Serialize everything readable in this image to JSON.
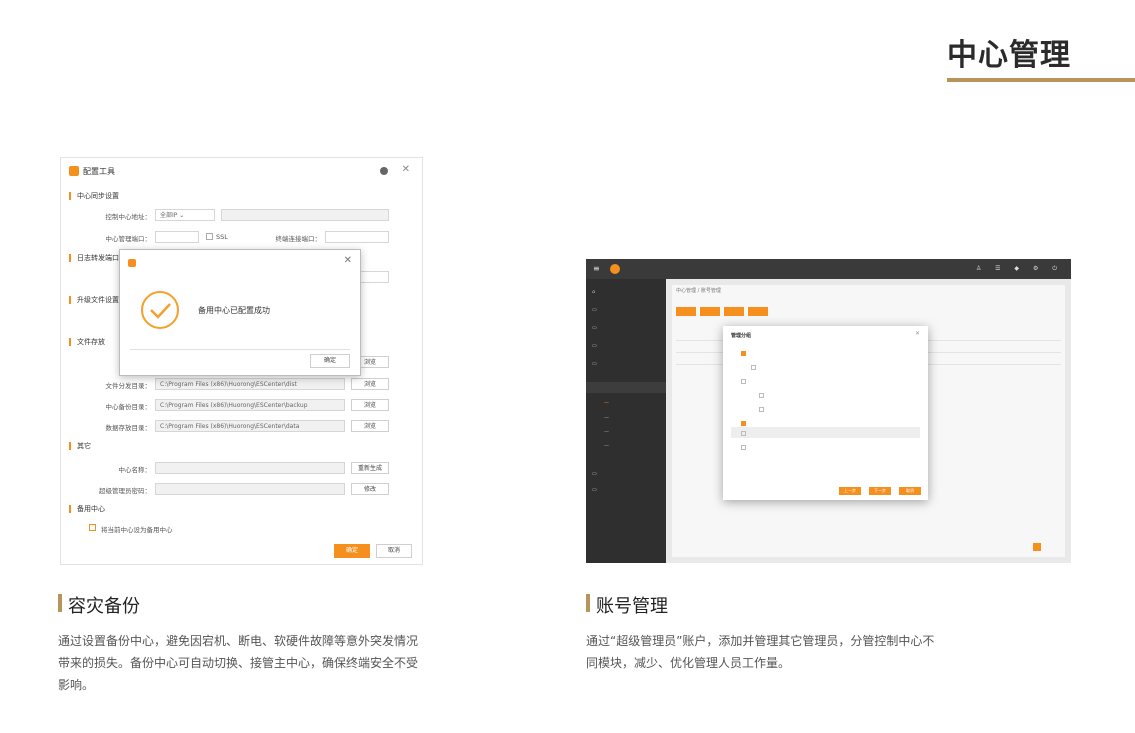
{
  "page": {
    "title": "中心管理",
    "accent": "#b8935a",
    "brand": "#f5901e"
  },
  "left_shot": {
    "title": "配置工具",
    "sections": {
      "sync": "中心同步设置",
      "forward": "日志转发端口",
      "upgrade": "升级文件设置",
      "storage": "文件存放",
      "other": "其它",
      "backup": "备用中心"
    },
    "fields": {
      "master_label": "控制中心地址：",
      "master_value": "全部IP",
      "port_label": "中心管理端口：",
      "ssl": "SSL",
      "agent_port_label": "终端连接端口：",
      "client_dir_label": "文件分发目录：",
      "client_dir_value": "C:\\Program Files (x86)\\Huorong\\ESCenter\\dist",
      "backup_dir_label": "中心备份目录：",
      "backup_dir_value": "C:\\Program Files (x86)\\Huorong\\ESCenter\\backup",
      "data_dir_label": "数据存放目录：",
      "data_dir_value": "C:\\Program Files (x86)\\Huorong\\ESCenter\\data",
      "browse": "浏览",
      "name_label": "中心名称：",
      "name_btn": "重新生成",
      "password_label": "超级管理员密码：",
      "password_btn": "修改",
      "backup_check": "将当前中心设为备用中心"
    },
    "buttons": {
      "ok": "确定",
      "cancel": "取消"
    },
    "modal": {
      "message": "备用中心已配置成功",
      "button": "确定"
    }
  },
  "right_shot": {
    "crumb": "中心管理 / 账号管理",
    "dialog_title": "管理分组",
    "buttons": [
      "上一步",
      "下一步",
      "取消"
    ]
  },
  "features": [
    {
      "title": "容灾备份",
      "desc": "通过设置备份中心，避免因宕机、断电、软硬件故障等意外突发情况带来的损失。备份中心可自动切换、接管主中心，确保终端安全不受影响。"
    },
    {
      "title": "账号管理",
      "desc": "通过“超级管理员”账户，添加并管理其它管理员，分管控制中心不同模块，减少、优化管理人员工作量。"
    }
  ]
}
